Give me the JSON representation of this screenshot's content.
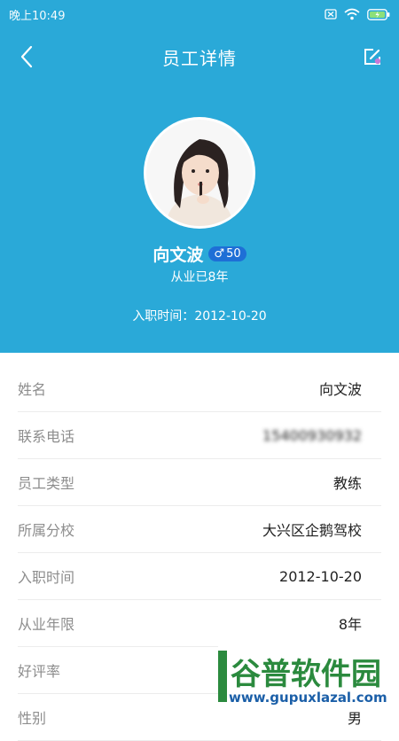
{
  "status_bar": {
    "time": "晚上10:49"
  },
  "nav": {
    "title": "员工详情"
  },
  "profile": {
    "name": "向文波",
    "gender_symbol": "♂",
    "age": "50",
    "years_text": "从业已8年",
    "join_label": "入职时间：",
    "join_date": "2012-10-20"
  },
  "details": [
    {
      "label": "姓名",
      "value": "向文波"
    },
    {
      "label": "联系电话",
      "value": "15400930932"
    },
    {
      "label": "员工类型",
      "value": "教练"
    },
    {
      "label": "所属分校",
      "value": "大兴区企鹅驾校"
    },
    {
      "label": "入职时间",
      "value": "2012-10-20"
    },
    {
      "label": "从业年限",
      "value": "8年"
    },
    {
      "label": "好评率",
      "value": ""
    },
    {
      "label": "性别",
      "value": "男"
    }
  ],
  "watermark": {
    "brand": "谷普软件园",
    "url": "www.gupuxlazal.com"
  },
  "colors": {
    "header": "#2aa9d8",
    "badge": "#1e6fd6",
    "watermark_green": "#2b8a3e",
    "watermark_url": "#1b5fa8"
  }
}
